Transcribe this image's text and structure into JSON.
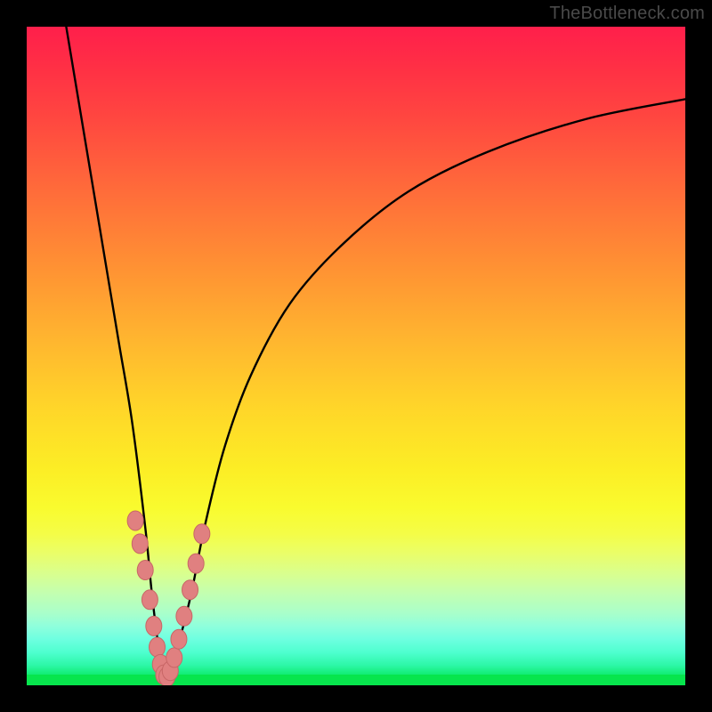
{
  "watermark": "TheBottleneck.com",
  "colors": {
    "frame": "#000000",
    "curve_stroke": "#000000",
    "good_zone": "#07e54d",
    "bad_zone": "#ff1f4b",
    "marker_fill": "#e08080",
    "marker_stroke": "#c86666"
  },
  "chart_data": {
    "type": "line",
    "title": "",
    "xlabel": "",
    "ylabel": "",
    "xlim": [
      0,
      100
    ],
    "ylim": [
      0,
      100
    ],
    "note": "Bottleneck percentage (y) vs relative component strength (x). Minimum bottleneck at x≈21. No numeric axes shown.",
    "series": [
      {
        "name": "bottleneck",
        "x": [
          6,
          8,
          10,
          12,
          14,
          16,
          18,
          19,
          20,
          21,
          22,
          23,
          25,
          27,
          30,
          34,
          40,
          48,
          58,
          70,
          85,
          100
        ],
        "values": [
          100,
          88,
          76,
          64,
          52,
          40,
          24,
          14,
          6,
          1,
          2,
          6,
          14,
          24,
          36,
          47,
          58,
          67,
          75,
          81,
          86,
          89
        ]
      }
    ],
    "markers": {
      "name": "highlighted-points",
      "x": [
        16.5,
        17.2,
        18.0,
        18.7,
        19.3,
        19.8,
        20.3,
        20.8,
        21.3,
        21.8,
        22.4,
        23.1,
        23.9,
        24.8,
        25.7,
        26.6
      ],
      "values": [
        25.0,
        21.5,
        17.5,
        13.0,
        9.0,
        5.8,
        3.2,
        1.6,
        1.3,
        2.2,
        4.2,
        7.0,
        10.5,
        14.5,
        18.5,
        23.0
      ]
    }
  }
}
